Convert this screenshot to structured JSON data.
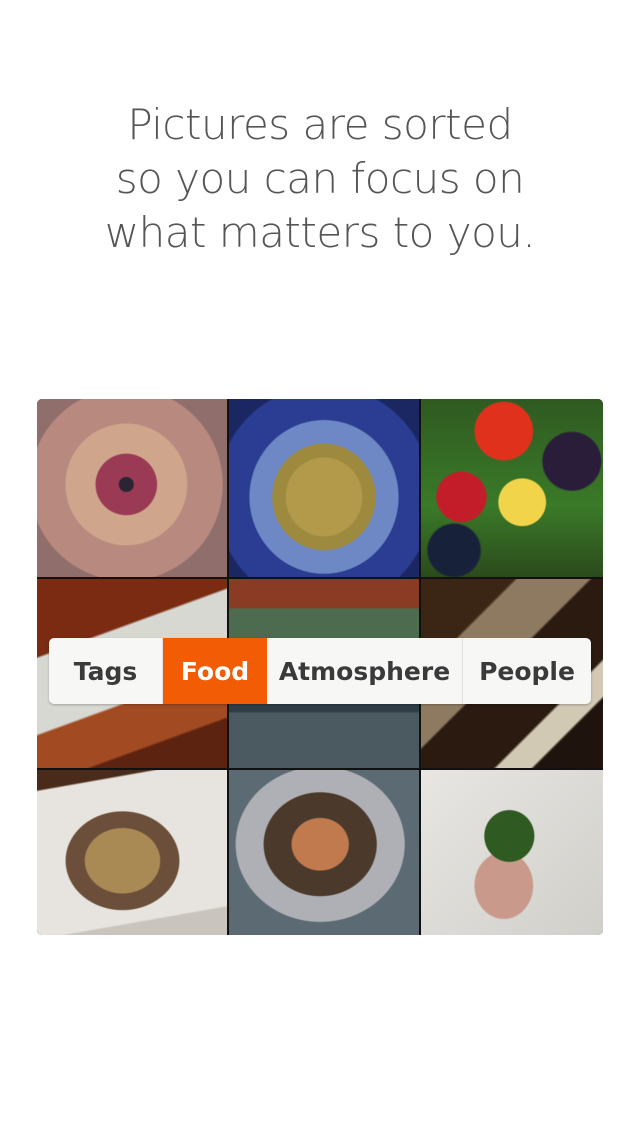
{
  "headline": {
    "line1": "Pictures are sorted",
    "line2": "so you can focus on",
    "line3": "what matters to you."
  },
  "segmented_control": {
    "options": [
      "Tags",
      "Food",
      "Atmosphere",
      "People"
    ],
    "selected": "Food"
  },
  "colors": {
    "accent": "#f25c05",
    "headline_text": "#555555",
    "segment_text": "#3a3a3a",
    "segment_background": "#f7f7f6"
  }
}
